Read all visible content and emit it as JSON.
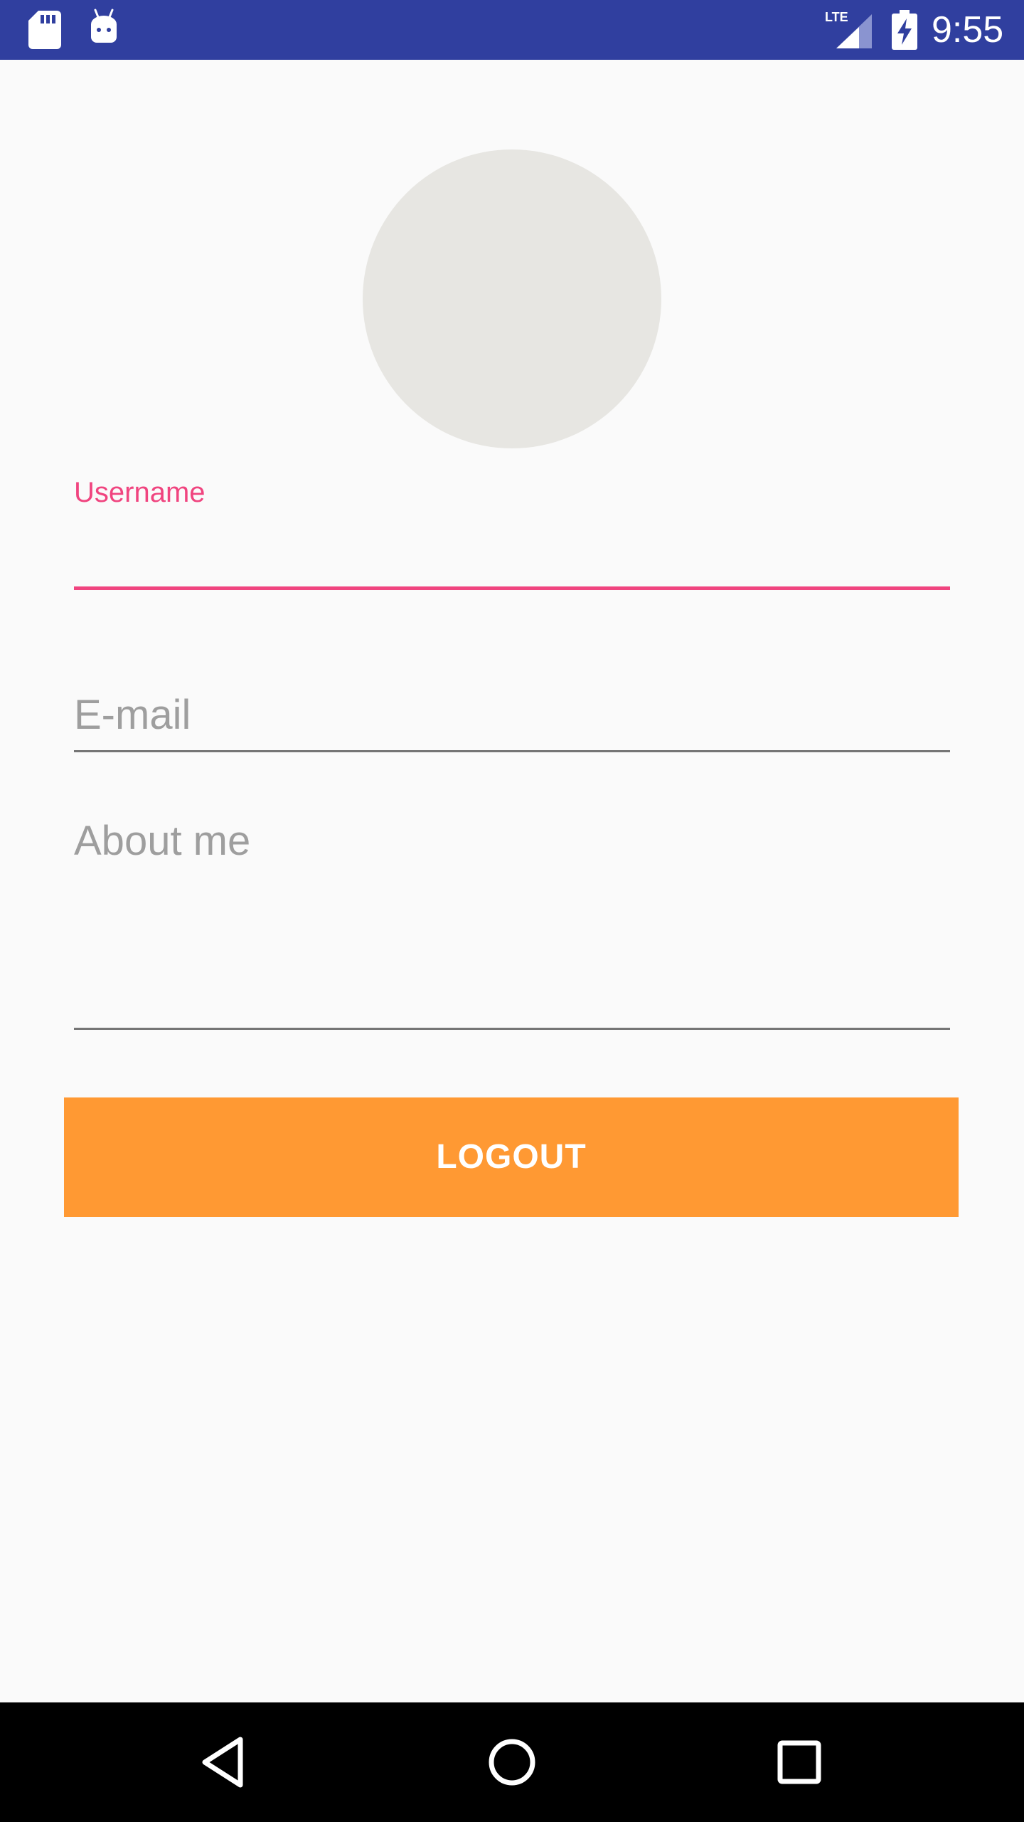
{
  "status_bar": {
    "time": "9:55",
    "network_label": "LTE",
    "icons": [
      "sd-card-icon",
      "android-debug-icon",
      "lte-signal-icon",
      "battery-charging-icon"
    ]
  },
  "profile": {
    "avatar_color": "#e7e6e2",
    "username_label": "Username",
    "username_value": "",
    "email_placeholder": "E-mail",
    "email_value": "",
    "about_placeholder": "About me",
    "about_value": ""
  },
  "actions": {
    "logout_label": "LOGOUT"
  },
  "nav_bar": {
    "icons": [
      "back-icon",
      "home-icon",
      "recents-icon"
    ]
  },
  "colors": {
    "status_bar": "#303f9f",
    "accent": "#f0447f",
    "button": "#ff9933",
    "background": "#fafafa"
  }
}
